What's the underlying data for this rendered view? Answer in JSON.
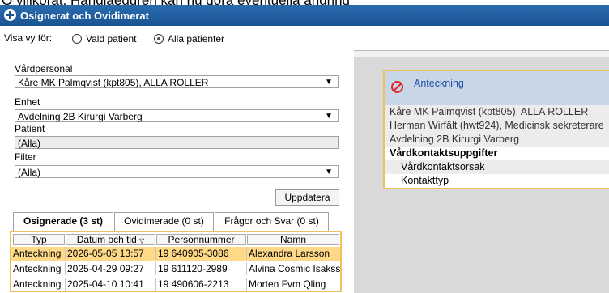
{
  "caption": "O villkorat. Handlaeduren kan nu gora eventuella andring",
  "window": {
    "title": "Osignerat och Ovidimerat"
  },
  "view": {
    "label": "Visa vy för:",
    "options": [
      {
        "label": "Vald patient",
        "selected": false
      },
      {
        "label": "Alla patienter",
        "selected": true
      }
    ]
  },
  "filters": {
    "vardpersonal_label": "Vårdpersonal",
    "vardpersonal_value": "Kåre MK Palmqvist (kpt805), ALLA ROLLER",
    "enhet_label": "Enhet",
    "enhet_value": "Avdelning 2B Kirurgi Varberg",
    "patient_label": "Patient",
    "patient_value": "(Alla)",
    "filter_label": "Filter",
    "filter_value": "(Alla)",
    "update_button": "Uppdatera"
  },
  "tabs": [
    {
      "label": "Osignerade  (3 st)",
      "active": true
    },
    {
      "label": "Ovidimerade  (0 st)",
      "active": false
    },
    {
      "label": "Frågor och Svar  (0 st)",
      "active": false
    }
  ],
  "table": {
    "headers": [
      "Typ",
      "Datum och tid",
      "Personnummer",
      "Namn"
    ],
    "rows": [
      {
        "typ": "Anteckning",
        "datum": "2026-05-05 13:57",
        "pnr": "19 640905-3086",
        "namn": "Alexandra Larsson",
        "selected": true
      },
      {
        "typ": "Anteckning",
        "datum": "2025-04-29 09:27",
        "pnr": "19 611120-2989",
        "namn": "Alvina Cosmic Isaksso",
        "selected": false
      },
      {
        "typ": "Anteckning",
        "datum": "2025-04-10 10:41",
        "pnr": "19 490606-2213",
        "namn": "Morten Fvm Qling",
        "selected": false
      }
    ]
  },
  "preview": {
    "title": "Anteckning",
    "lines": [
      "Kåre MK Palmqvist (kpt805), ALLA ROLLER",
      "Herman Wirfält (hwt924), Medicinsk sekreterare",
      "Avdelning 2B Kirurgi Varberg"
    ],
    "section": "Vårdkontaktsuppgifter",
    "items": [
      "Vårdkontaktsorsak",
      "Kontakttyp"
    ]
  }
}
